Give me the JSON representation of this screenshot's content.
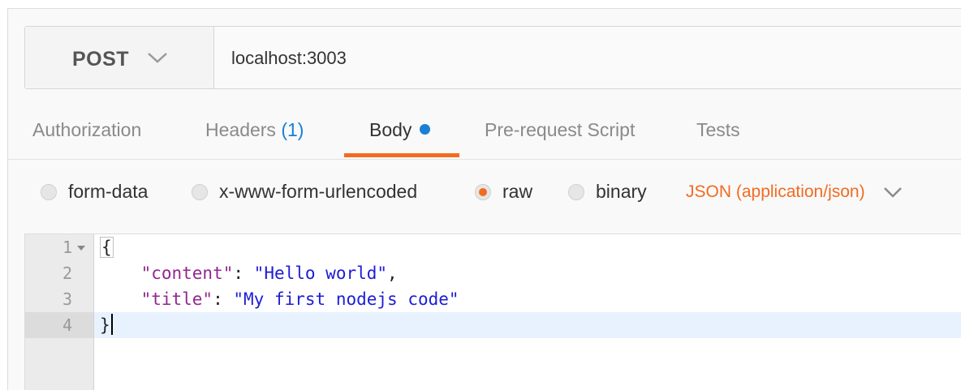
{
  "request": {
    "method": "POST",
    "url": "localhost:3003"
  },
  "tabs": [
    {
      "label": "Authorization"
    },
    {
      "label": "Headers",
      "count": "(1)"
    },
    {
      "label": "Body",
      "active": true
    },
    {
      "label": "Pre-request Script"
    },
    {
      "label": "Tests"
    }
  ],
  "body_types": [
    {
      "label": "form-data",
      "selected": false
    },
    {
      "label": "x-www-form-urlencoded",
      "selected": false
    },
    {
      "label": "raw",
      "selected": true
    },
    {
      "label": "binary",
      "selected": false
    }
  ],
  "format": {
    "selected": "JSON (application/json)"
  },
  "editor": {
    "line_numbers": [
      "1",
      "2",
      "3",
      "4"
    ],
    "active_line": 4,
    "lines": {
      "open": "{",
      "l2_key": "\"content\"",
      "l2_sep": ": ",
      "l2_val": "\"Hello world\"",
      "l2_end": ",",
      "l3_key": "\"title\"",
      "l3_sep": ": ",
      "l3_val": "\"My first nodejs code\"",
      "close": "}"
    }
  },
  "colors": {
    "accent": "#f26b21",
    "link_blue": "#1a7fd5",
    "json_key": "#92278f",
    "json_string": "#1d1cd6"
  }
}
